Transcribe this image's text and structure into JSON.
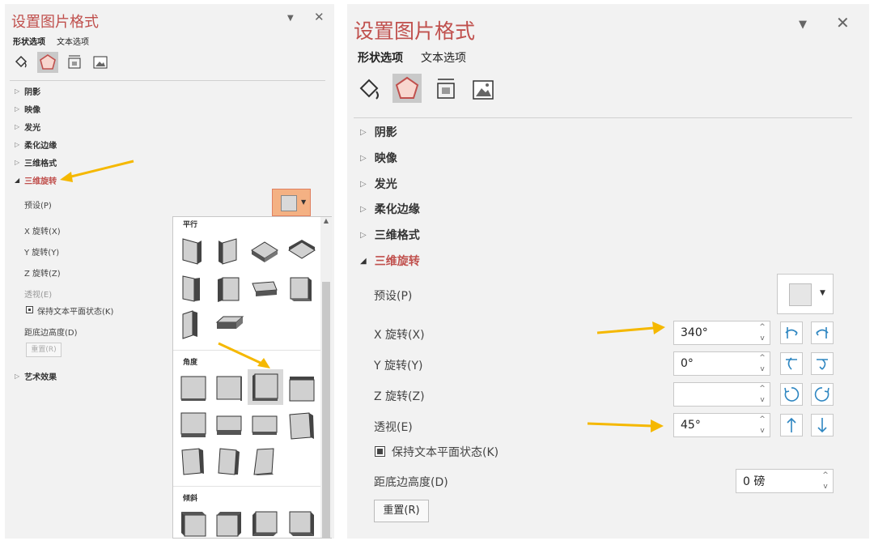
{
  "left": {
    "title": "设置图片格式",
    "tabs": [
      "形状选项",
      "文本选项"
    ],
    "sections": [
      {
        "label": "阴影",
        "expanded": false
      },
      {
        "label": "映像",
        "expanded": false
      },
      {
        "label": "发光",
        "expanded": false
      },
      {
        "label": "柔化边缘",
        "expanded": false
      },
      {
        "label": "三维格式",
        "expanded": false
      },
      {
        "label": "三维旋转",
        "expanded": true
      }
    ],
    "fields": {
      "preset": "预设(P)",
      "x": "X 旋转(X)",
      "y": "Y 旋转(Y)",
      "z": "Z 旋转(Z)",
      "perspective": "透视(E)",
      "keep_flat": "保持文本平面状态(K)",
      "distance": "距底边高度(D)",
      "reset": "重置(R)",
      "art": "艺术效果"
    },
    "gallery": {
      "groups": [
        "平行",
        "角度",
        "倾斜"
      ]
    }
  },
  "right": {
    "title": "设置图片格式",
    "tabs": [
      "形状选项",
      "文本选项"
    ],
    "sections": [
      {
        "label": "阴影",
        "expanded": false
      },
      {
        "label": "映像",
        "expanded": false
      },
      {
        "label": "发光",
        "expanded": false
      },
      {
        "label": "柔化边缘",
        "expanded": false
      },
      {
        "label": "三维格式",
        "expanded": false
      },
      {
        "label": "三维旋转",
        "expanded": true
      }
    ],
    "fields": {
      "preset": "预设(P)",
      "x_label": "X 旋转(X)",
      "x_value": "340°",
      "y_label": "Y 旋转(Y)",
      "y_value": "0°",
      "z_label": "Z 旋转(Z)",
      "z_value": "",
      "perspective_label": "透视(E)",
      "perspective_value": "45°",
      "keep_flat": "保持文本平面状态(K)",
      "distance_label": "距底边高度(D)",
      "distance_value": "0 磅",
      "reset": "重置(R)"
    }
  },
  "colors": {
    "accent": "#c0504d",
    "highlight": "#f4b183",
    "arrow": "#f5b800"
  }
}
